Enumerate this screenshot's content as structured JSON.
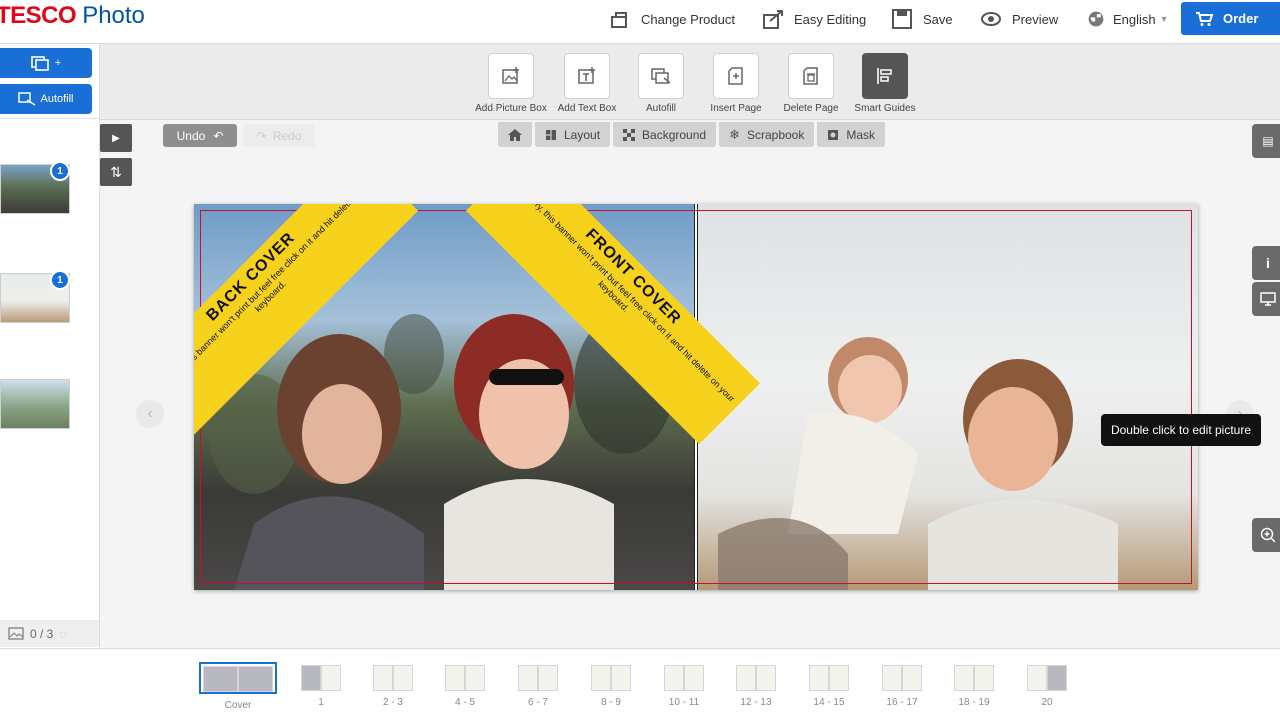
{
  "header": {
    "brand": "TESCO",
    "product": "Photo",
    "nav": [
      {
        "label": "Change Product",
        "icon": "change-product-icon"
      },
      {
        "label": "Easy Editing",
        "icon": "easy-editing-icon"
      },
      {
        "label": "Save",
        "icon": "save-icon"
      },
      {
        "label": "Preview",
        "icon": "eye-icon"
      },
      {
        "label": "English",
        "icon": "globe-icon"
      }
    ],
    "order_label": "Order"
  },
  "left_panel": {
    "add_photos_label": "+",
    "autofill_label": "Autofill",
    "photos": [
      {
        "badge": "1"
      },
      {
        "badge": "1"
      },
      {
        "badge": ""
      }
    ],
    "counter": "0 / 3"
  },
  "toolbar": {
    "tools": [
      {
        "label": "Add Picture Box",
        "icon": "add-picture-box-icon"
      },
      {
        "label": "Add Text Box",
        "icon": "add-text-box-icon"
      },
      {
        "label": "Autofill",
        "icon": "autofill-icon"
      },
      {
        "label": "Insert Page",
        "icon": "insert-page-icon"
      },
      {
        "label": "Delete Page",
        "icon": "delete-page-icon"
      },
      {
        "label": "Smart Guides",
        "icon": "smart-guides-icon"
      }
    ]
  },
  "canvas": {
    "undo_label": "Undo",
    "redo_label": "Redo",
    "tabs": [
      {
        "label": "",
        "icon": "home-icon"
      },
      {
        "label": "Layout",
        "icon": "layout-icon"
      },
      {
        "label": "Background",
        "icon": "background-icon"
      },
      {
        "label": "Scrapbook",
        "icon": "scrapbook-icon"
      },
      {
        "label": "Mask",
        "icon": "mask-icon"
      }
    ],
    "back_banner": {
      "title": "BACK COVER",
      "text": "Don't worry, this banner won't print but feel free click on it and hit delete on your keyboard."
    },
    "front_banner": {
      "title": "FRONT COVER",
      "text": "Don't worry, this banner won't print but feel free click on it and hit delete on your keyboard."
    },
    "tooltip": "Double click to edit picture"
  },
  "pages": [
    {
      "label": "Cover",
      "selected": true
    },
    {
      "label": "1"
    },
    {
      "label": "2 - 3"
    },
    {
      "label": "4 - 5"
    },
    {
      "label": "6 - 7"
    },
    {
      "label": "8 - 9"
    },
    {
      "label": "10 - 11"
    },
    {
      "label": "12 - 13"
    },
    {
      "label": "14 - 15"
    },
    {
      "label": "16 - 17"
    },
    {
      "label": "18 - 19"
    },
    {
      "label": "20"
    }
  ],
  "colors": {
    "accent": "#1a6fd6",
    "brand_red": "#e0061a",
    "banner_yellow": "#f7d21d",
    "bleed_line": "#c8102e"
  }
}
